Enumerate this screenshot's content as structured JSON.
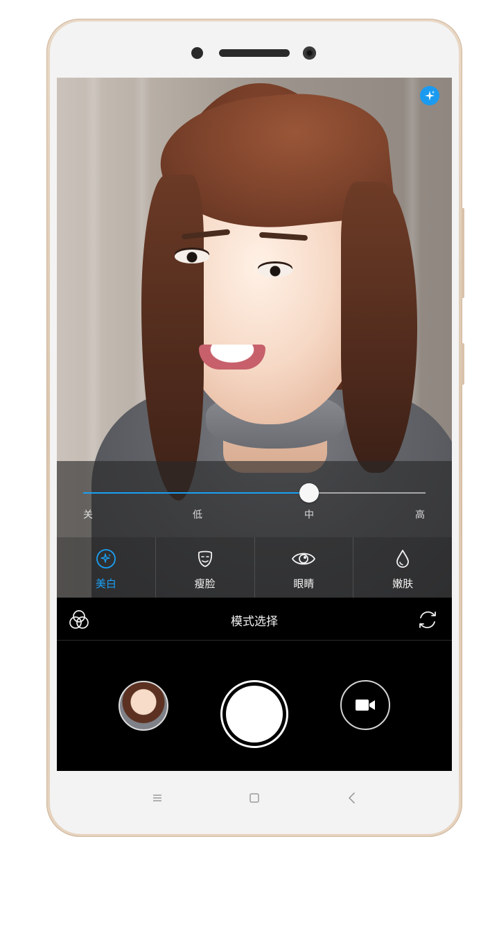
{
  "beauty": {
    "badge_icon": "sparkle-icon",
    "accent_color": "#1aa0f5",
    "slider": {
      "value_percent": 66,
      "levels": [
        {
          "label": "关"
        },
        {
          "label": "低"
        },
        {
          "label": "中"
        },
        {
          "label": "高"
        }
      ]
    },
    "tabs": [
      {
        "label": "美白",
        "icon": "sparkle-circle-icon",
        "active": true
      },
      {
        "label": "瘦脸",
        "icon": "face-mask-icon",
        "active": false
      },
      {
        "label": "眼睛",
        "icon": "eye-icon",
        "active": false
      },
      {
        "label": "嫩肤",
        "icon": "droplet-icon",
        "active": false
      }
    ]
  },
  "mode_bar": {
    "title": "模式选择",
    "filter_icon": "filter-circles-icon",
    "flip_icon": "switch-camera-icon"
  },
  "controls": {
    "gallery_icon": "gallery-thumbnail",
    "shutter_icon": "shutter-button",
    "video_icon": "video-camera-icon"
  },
  "nav_keys": {
    "menu_icon": "menu-icon",
    "home_icon": "home-icon",
    "back_icon": "back-icon"
  }
}
